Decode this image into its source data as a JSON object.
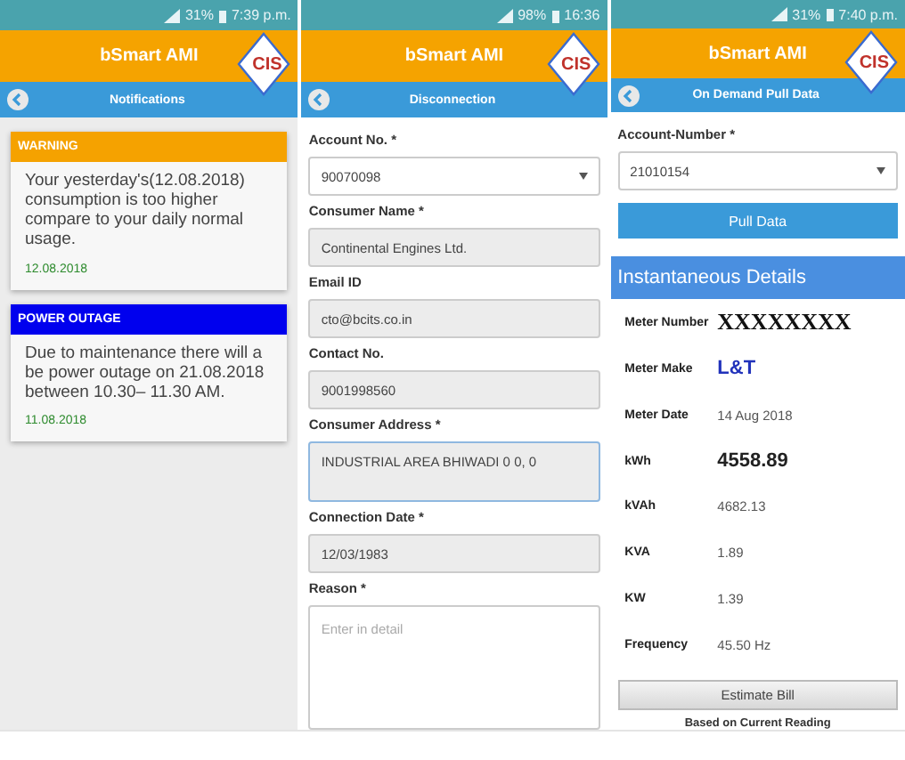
{
  "phones": [
    {
      "kind": "notifications",
      "status": {
        "battery": "31%",
        "time": "7:39 p.m."
      },
      "app_title": "bSmart AMI",
      "logo": "CIS",
      "screen_title": "Notifications",
      "notifications": [
        {
          "heading": "WARNING",
          "color": "#f5a200",
          "message": "Your yesterday's(12.08.2018) consumption is too higher compare to your daily normal usage.",
          "date": "12.08.2018"
        },
        {
          "heading": "POWER OUTAGE",
          "color": "#0000ee",
          "message": "Due to maintenance there will a be power outage on 21.08.2018 between 10.30– 11.30 AM.",
          "date": "11.08.2018"
        }
      ]
    },
    {
      "kind": "form",
      "status": {
        "battery": "98%",
        "time": "16:36"
      },
      "app_title": "bSmart AMI",
      "logo": "CIS",
      "screen_title": "Disconnection",
      "fields": [
        {
          "label": "Account No. *",
          "kind": "dropdown",
          "value": "90070098",
          "focused": false
        },
        {
          "label": "Consumer Name *",
          "kind": "readonly",
          "value": "Continental Engines Ltd.",
          "focused": false
        },
        {
          "label": "Email ID",
          "kind": "readonly",
          "value": "cto@bcits.co.in",
          "focused": false
        },
        {
          "label": "Contact No.",
          "kind": "readonly",
          "value": "9001998560",
          "focused": false
        },
        {
          "label": "Consumer Address *",
          "kind": "area",
          "value": "INDUSTRIAL AREA BHIWADI 0 0, 0",
          "focused": true
        },
        {
          "label": "Connection Date *",
          "kind": "readonly",
          "value": "12/03/1983",
          "focused": false
        },
        {
          "label": "Reason *",
          "kind": "textarea",
          "placeholder": "Enter in detail",
          "focused": false
        }
      ]
    },
    {
      "kind": "pull_data",
      "status": {
        "battery": "31%",
        "time": "7:40 p.m."
      },
      "app_title": "bSmart AMI",
      "logo": "CIS",
      "screen_title": "On Demand Pull Data",
      "fields": [
        {
          "label": "Account-Number *",
          "kind": "dropdown",
          "value": "21010154",
          "focused": false
        }
      ],
      "button": "Pull Data",
      "section_title": "Instantaneous Details",
      "readings": [
        {
          "label": "Meter Number",
          "value": "XXXXXXXX",
          "kind": "masked"
        },
        {
          "label": "Meter Make",
          "value": "L&T",
          "kind": "brand"
        },
        {
          "label": "Meter Date",
          "value": "14 Aug 2018",
          "kind": "plain"
        },
        {
          "label": "kWh",
          "value": "4558.89",
          "kind": "bold"
        },
        {
          "label": "kVAh",
          "value": "4682.13",
          "kind": "plain"
        },
        {
          "label": "KVA",
          "value": "1.89",
          "kind": "plain"
        },
        {
          "label": "KW",
          "value": "1.39",
          "kind": "plain"
        },
        {
          "label": "Frequency",
          "value": "45.50 Hz",
          "kind": "plain"
        }
      ],
      "estimate_button": "Estimate Bill",
      "estimate_caption": "Based on Current Reading"
    }
  ]
}
